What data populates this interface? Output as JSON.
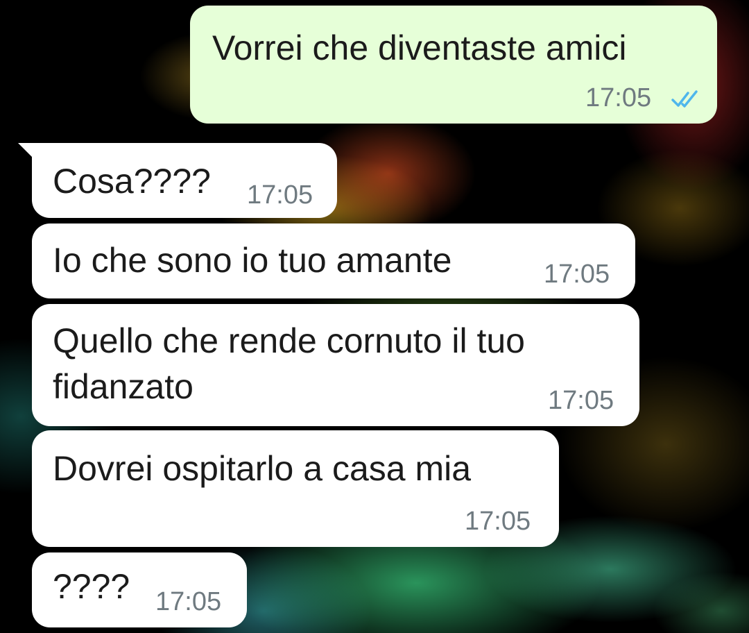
{
  "chat": {
    "messages": [
      {
        "direction": "outgoing",
        "text": "Vorrei che diventaste amici",
        "time": "17:05",
        "status": "read"
      },
      {
        "direction": "incoming",
        "text": "Cosa????",
        "time": "17:05"
      },
      {
        "direction": "incoming",
        "text": "Io che sono io tuo amante",
        "time": "17:05"
      },
      {
        "direction": "incoming",
        "lines": [
          "Quello che rende cornuto il tuo",
          "fidanzato"
        ],
        "time": "17:05"
      },
      {
        "direction": "incoming",
        "text": "Dovrei ospitarlo a casa mia",
        "time": "17:05"
      },
      {
        "direction": "incoming",
        "text": "????",
        "time": "17:05"
      }
    ]
  },
  "icons": {
    "read_receipt": "double-check-icon"
  },
  "colors": {
    "outgoing_bubble": "#e6ffd8",
    "incoming_bubble": "#ffffff",
    "read_tick": "#4fb6ec",
    "time_text": "#6f7a80"
  }
}
